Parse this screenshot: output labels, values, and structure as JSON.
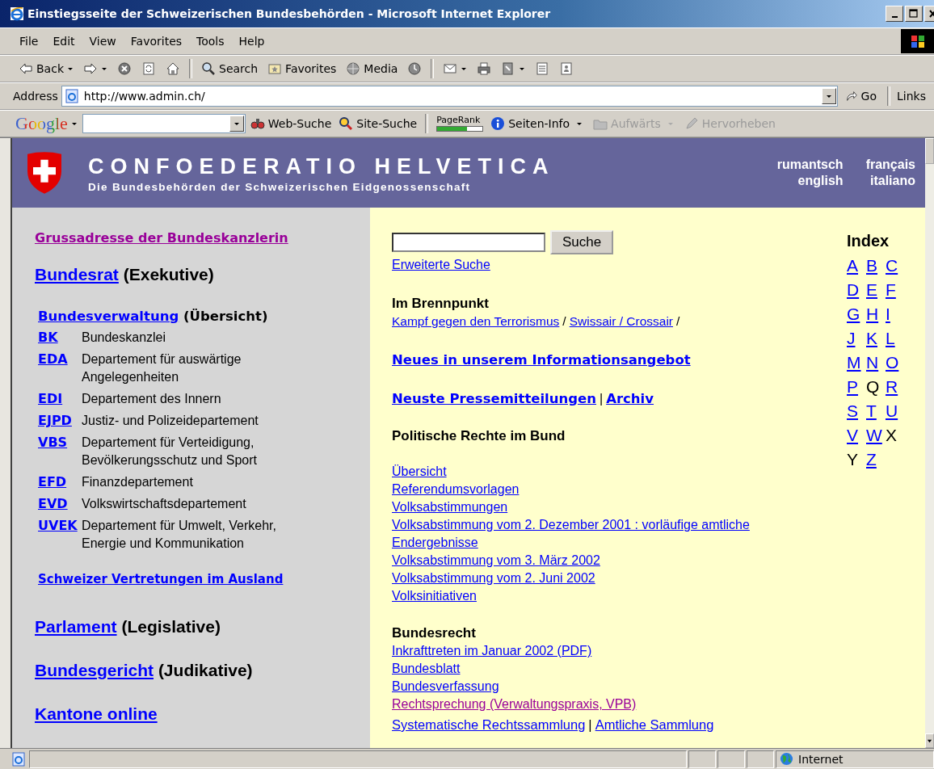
{
  "window": {
    "title": "Einstiegsseite der Schweizerischen Bundesbehörden - Microsoft Internet Explorer"
  },
  "menu": [
    "File",
    "Edit",
    "View",
    "Favorites",
    "Tools",
    "Help"
  ],
  "toolbar": [
    {
      "kind": "back",
      "label": "Back",
      "dropdown": true
    },
    {
      "kind": "forward",
      "dropdown": true
    },
    {
      "kind": "stop",
      "dropdown": false
    },
    {
      "kind": "refresh",
      "dropdown": false
    },
    {
      "kind": "home",
      "dropdown": false
    },
    {
      "kind": "sep"
    },
    {
      "kind": "search",
      "label": "Search",
      "dropdown": false
    },
    {
      "kind": "favorites",
      "label": "Favorites",
      "dropdown": false
    },
    {
      "kind": "media",
      "label": "Media",
      "dropdown": false
    },
    {
      "kind": "history",
      "dropdown": false
    },
    {
      "kind": "sep"
    },
    {
      "kind": "mail",
      "dropdown": true
    },
    {
      "kind": "print",
      "dropdown": false
    },
    {
      "kind": "edit",
      "dropdown": true
    },
    {
      "kind": "discuss",
      "dropdown": false
    },
    {
      "kind": "messenger",
      "dropdown": false
    }
  ],
  "address": {
    "label": "Address",
    "url": "http://www.admin.ch/",
    "go": "Go",
    "links": "Links"
  },
  "google_bar": {
    "logo": "Google",
    "items": [
      {
        "kind": "web",
        "label": "Web-Suche",
        "disabled": false,
        "dropdown": false
      },
      {
        "kind": "site",
        "label": "Site-Suche",
        "disabled": false,
        "dropdown": false
      },
      {
        "kind": "sep"
      },
      {
        "kind": "pagerank",
        "label": "PageRank",
        "level": 0.65
      },
      {
        "kind": "info",
        "label": "Seiten-Info",
        "disabled": false,
        "dropdown": true
      },
      {
        "kind": "up",
        "label": "Aufwärts",
        "disabled": true,
        "dropdown": true
      },
      {
        "kind": "highlight",
        "label": "Hervorheben",
        "disabled": true,
        "dropdown": false
      }
    ]
  },
  "header": {
    "title": "CONFOEDERATIO HELVETICA",
    "subtitle": "Die Bundesbehörden der Schweizerischen Eidgenossenschaft",
    "languages": [
      "rumantsch",
      "français",
      "english",
      "italiano"
    ]
  },
  "left": {
    "greeting": {
      "text": "Grussadresse der Bundeskanzlerin",
      "visited": true
    },
    "executive": {
      "link": "Bundesrat",
      "note": "(Exekutive)"
    },
    "administration": {
      "link": "Bundesverwaltung",
      "note": "(Übersicht)"
    },
    "departments": [
      {
        "abbr": "BK",
        "name": "Bundeskanzlei"
      },
      {
        "abbr": "EDA",
        "name": "Departement für auswärtige Angelegenheiten"
      },
      {
        "abbr": "EDI",
        "name": "Departement des Innern"
      },
      {
        "abbr": "EJPD",
        "name": "Justiz- und Polizeidepartement"
      },
      {
        "abbr": "VBS",
        "name": "Departement für Verteidigung, Bevölkerungsschutz und Sport"
      },
      {
        "abbr": "EFD",
        "name": "Finanzdepartement"
      },
      {
        "abbr": "EVD",
        "name": "Volkswirtschaftsdepartement"
      },
      {
        "abbr": "UVEK",
        "name": "Departement für Umwelt, Verkehr, Energie und Kommunikation"
      }
    ],
    "abroad": "Schweizer Vertretungen im Ausland",
    "branches": [
      {
        "link": "Parlament",
        "note": "(Legislative)"
      },
      {
        "link": "Bundesgericht",
        "note": "(Judikative)"
      }
    ],
    "cantons": "Kantone online"
  },
  "right": {
    "search": {
      "button": "Suche",
      "advanced": "Erweiterte Suche"
    },
    "focus": {
      "heading": "Im Brennpunkt",
      "parts": [
        {
          "kind": "link",
          "text": "Kampf gegen den Terrorismus"
        },
        {
          "kind": "text",
          "text": "/"
        },
        {
          "kind": "link",
          "text": "Swissair / Crossair"
        },
        {
          "kind": "text",
          "text": "/"
        }
      ]
    },
    "news": "Neues in unserem Informationsangebot",
    "press": [
      {
        "kind": "link",
        "text": "Neuste Pressemitteilungen"
      },
      {
        "kind": "text",
        "text": "|"
      },
      {
        "kind": "link",
        "text": "Archiv"
      }
    ],
    "politics": {
      "heading": "Politische Rechte im Bund",
      "links": [
        "Übersicht",
        "Referendumsvorlagen",
        "Volksabstimmungen",
        "Volksabstimmung vom 2. Dezember 2001 : vorläufige amtliche Endergebnisse",
        "Volksabstimmung vom 3. März 2002",
        "Volksabstimmung vom 2. Juni 2002",
        "Volksinitiativen"
      ]
    },
    "law": {
      "heading": "Bundesrecht",
      "links": [
        {
          "text": "Inkrafttreten im Januar 2002 (PDF)",
          "visited": false
        },
        {
          "text": "Bundesblatt",
          "visited": false
        },
        {
          "text": "Bundesverfassung",
          "visited": false
        },
        {
          "text": "Rechtsprechung (Verwaltungspraxis, VPB)",
          "visited": true
        }
      ],
      "last": [
        {
          "kind": "link",
          "text": "Systematische Rechtssammlung"
        },
        {
          "kind": "text",
          "text": "|"
        },
        {
          "kind": "link",
          "text": "Amtliche Sammlung"
        }
      ]
    },
    "index": {
      "heading": "Index",
      "letters": [
        {
          "letter": "A",
          "link": true
        },
        {
          "letter": "B",
          "link": true
        },
        {
          "letter": "C",
          "link": true
        },
        {
          "letter": "D",
          "link": true
        },
        {
          "letter": "E",
          "link": true
        },
        {
          "letter": "F",
          "link": true
        },
        {
          "letter": "G",
          "link": true
        },
        {
          "letter": "H",
          "link": true
        },
        {
          "letter": "I",
          "link": true
        },
        {
          "letter": "J",
          "link": true
        },
        {
          "letter": "K",
          "link": true
        },
        {
          "letter": "L",
          "link": true
        },
        {
          "letter": "M",
          "link": true
        },
        {
          "letter": "N",
          "link": true
        },
        {
          "letter": "O",
          "link": true
        },
        {
          "letter": "P",
          "link": true
        },
        {
          "letter": "Q",
          "link": false
        },
        {
          "letter": "R",
          "link": true
        },
        {
          "letter": "S",
          "link": true
        },
        {
          "letter": "T",
          "link": true
        },
        {
          "letter": "U",
          "link": true
        },
        {
          "letter": "V",
          "link": true
        },
        {
          "letter": "W",
          "link": true
        },
        {
          "letter": "X",
          "link": false
        },
        {
          "letter": "Y",
          "link": false
        },
        {
          "letter": "Z",
          "link": true
        }
      ]
    }
  },
  "status_bar": {
    "zone": "Internet"
  }
}
